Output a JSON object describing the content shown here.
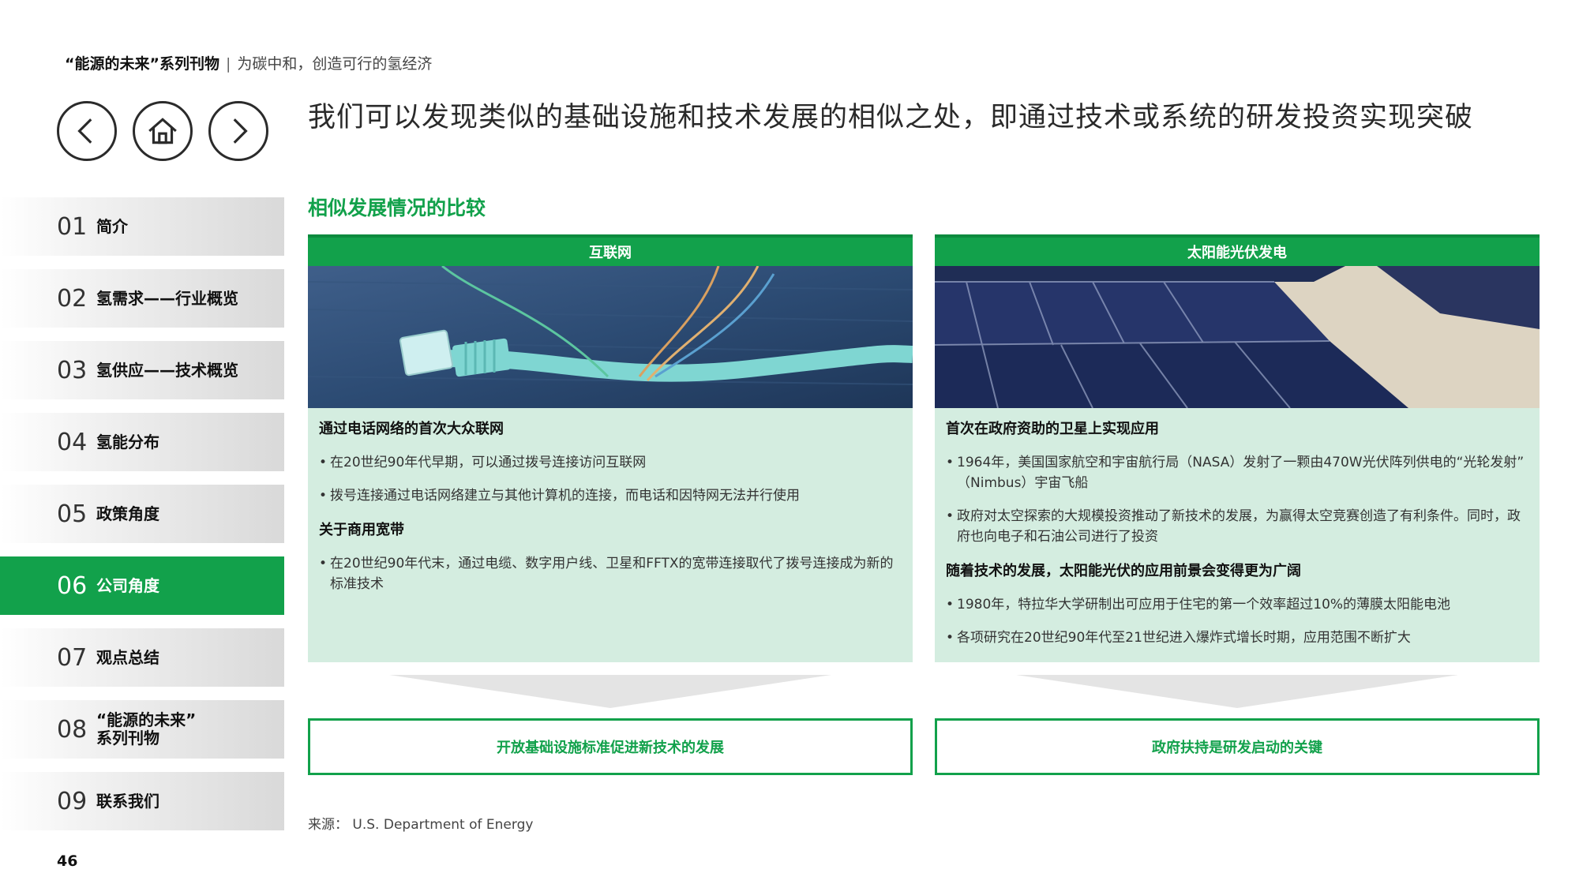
{
  "header": {
    "series": "“能源的未来”系列刊物",
    "separator": "|",
    "subtitle": "为碳中和，创造可行的氢经济",
    "headline": "我们可以发现类似的基础设施和技术发展的相似之处，即通过技术或系统的研发投资实现突破"
  },
  "nav_buttons": {
    "back_icon": "chevron-left-icon",
    "home_icon": "home-icon",
    "forward_icon": "chevron-right-icon"
  },
  "sidebar": {
    "items": [
      {
        "num": "01",
        "label": "简介"
      },
      {
        "num": "02",
        "label": "氢需求——行业概览"
      },
      {
        "num": "03",
        "label": "氢供应——技术概览"
      },
      {
        "num": "04",
        "label": "氢能分布"
      },
      {
        "num": "05",
        "label": "政策角度"
      },
      {
        "num": "06",
        "label": "公司角度"
      },
      {
        "num": "07",
        "label": "观点总结"
      },
      {
        "num": "08",
        "label": "“能源的未来”",
        "label2": "系列刊物"
      },
      {
        "num": "09",
        "label": "联系我们"
      }
    ],
    "active_index": 5
  },
  "page_number": "46",
  "section_title": "相似发展情况的比较",
  "columns": [
    {
      "title": "互联网",
      "image": "ethernet-cable-photo",
      "heading1": "通过电话网络的首次大众联网",
      "bullets1": [
        "在20世纪90年代早期，可以通过拨号连接访问互联网",
        "拨号连接通过电话网络建立与其他计算机的连接，而电话和因特网无法并行使用"
      ],
      "heading2": "关于商用宽带",
      "bullets2": [
        "在20世纪90年代末，通过电缆、数字用户线、卫星和FFTX的宽带连接取代了拨号连接成为新的标准技术"
      ],
      "result": "开放基础设施标准促进新技术的发展"
    },
    {
      "title": "太阳能光伏发电",
      "image": "solar-panels-photo",
      "heading1": "首次在政府资助的卫星上实现应用",
      "bullets1": [
        "1964年，美国国家航空和宇宙航行局（NASA）发射了一颗由470W光伏阵列供电的“光轮发射” （Nimbus）宇宙飞船",
        "政府对太空探索的大规模投资推动了新技术的发展，为赢得太空竞赛创造了有利条件。同时，政府也向电子和石油公司进行了投资"
      ],
      "heading2": "随着技术的发展，太阳能光伏的应用前景会变得更为广阔",
      "bullets2": [
        "1980年，特拉华大学研制出可应用于住宅的第一个效率超过10%的薄膜太阳能电池",
        "各项研究在20世纪90年代至21世纪进入爆炸式增长时期，应用范围不断扩大"
      ],
      "result": "政府扶持是研发启动的关键"
    }
  ],
  "source": "来源： U.S. Department of Energy",
  "colors": {
    "accent": "#12a14b",
    "panel": "#d4ede0"
  }
}
